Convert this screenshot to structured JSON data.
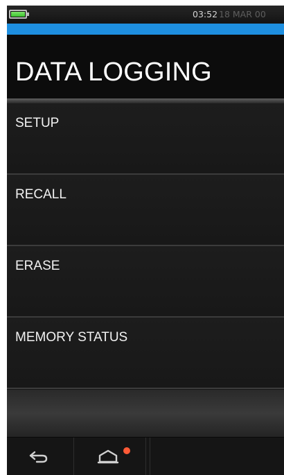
{
  "status_bar": {
    "time": "03:52",
    "date": "18 MAR 00",
    "battery_icon": "battery-icon",
    "battery_level": 1.0,
    "battery_color": "#3cc42f"
  },
  "accent_color": "#1e8fe0",
  "header": {
    "title": "DATA LOGGING"
  },
  "menu": {
    "items": [
      {
        "label": "SETUP"
      },
      {
        "label": "RECALL"
      },
      {
        "label": "ERASE"
      },
      {
        "label": "MEMORY STATUS"
      }
    ]
  },
  "nav": {
    "back_icon": "back-arrow-icon",
    "home_icon": "home-icon",
    "notification_color": "#ff5a36"
  }
}
